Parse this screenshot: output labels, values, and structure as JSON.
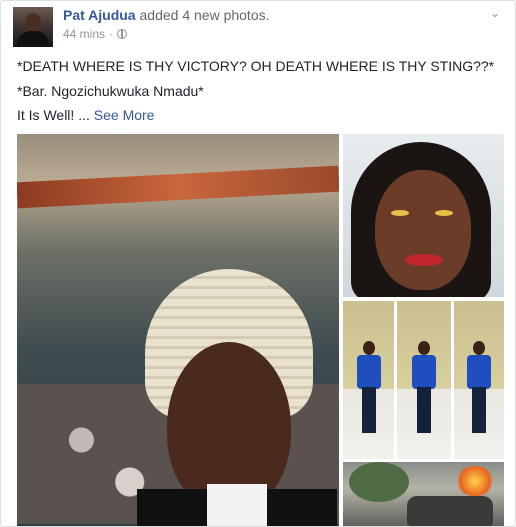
{
  "post": {
    "author": "Pat Ajudua",
    "action": "added 4 new photos.",
    "timestamp": "44 mins",
    "separator": "·",
    "lines": [
      "*DEATH WHERE IS THY VICTORY? OH DEATH WHERE IS THY STING??*",
      "*Bar. Ngozichukwuka Nmadu*",
      "It Is Well! ..."
    ],
    "see_more": "See More"
  },
  "icons": {
    "privacy": "globe-icon",
    "options": "chevron-down-icon"
  },
  "colors": {
    "link": "#365899",
    "meta": "#90949c",
    "text": "#1d2129",
    "border": "#dddfe2"
  }
}
